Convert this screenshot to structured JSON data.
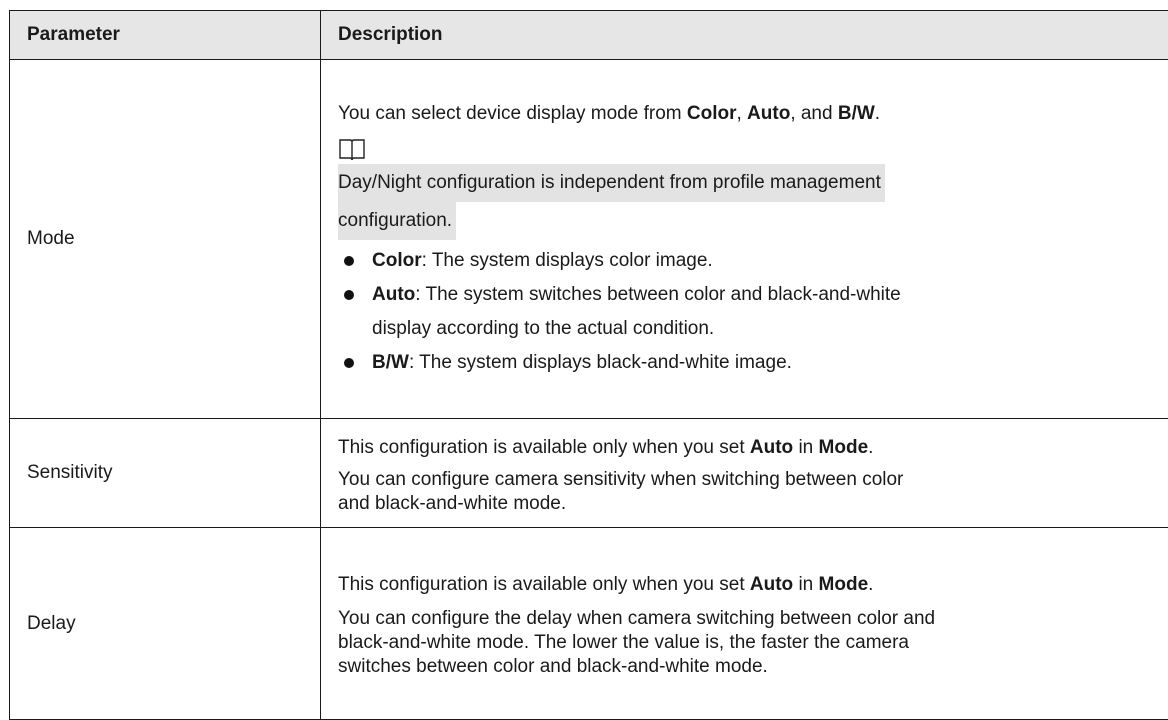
{
  "header": {
    "col_parameter": "Parameter",
    "col_description": "Description"
  },
  "rows": [
    {
      "parameter": "Mode",
      "intro": {
        "pre": "You can select device display mode from ",
        "b1": "Color",
        "sep1": ", ",
        "b2": "Auto",
        "sep2": ", and ",
        "b3": "B/W",
        "end": "."
      },
      "note_icon": "book-icon",
      "note_line1": "Day/Night configuration is independent from profile management",
      "note_line2": "configuration.",
      "bullets": [
        {
          "term": "Color",
          "text": ": The system displays color image."
        },
        {
          "term": "Auto",
          "text": ": The system switches between color and black-and-white",
          "cont": "display according to the actual condition."
        },
        {
          "term": "B/W",
          "text": ": The system displays black-and-white image."
        }
      ]
    },
    {
      "parameter": "Sensitivity",
      "avail": {
        "pre": "This configuration is available only when you set ",
        "b1": "Auto",
        "mid": " in ",
        "b2": "Mode",
        "end": "."
      },
      "line1": "You can configure camera sensitivity when switching between color",
      "line2": "and black-and-white mode."
    },
    {
      "parameter": "Delay",
      "avail": {
        "pre": "This configuration is available only when you set ",
        "b1": "Auto",
        "mid": " in ",
        "b2": "Mode",
        "end": "."
      },
      "line1": "You can configure the delay when camera switching between color and",
      "line2": "black-and-white mode. The lower the value is, the faster the camera",
      "line3": "switches between color and black-and-white mode."
    }
  ]
}
